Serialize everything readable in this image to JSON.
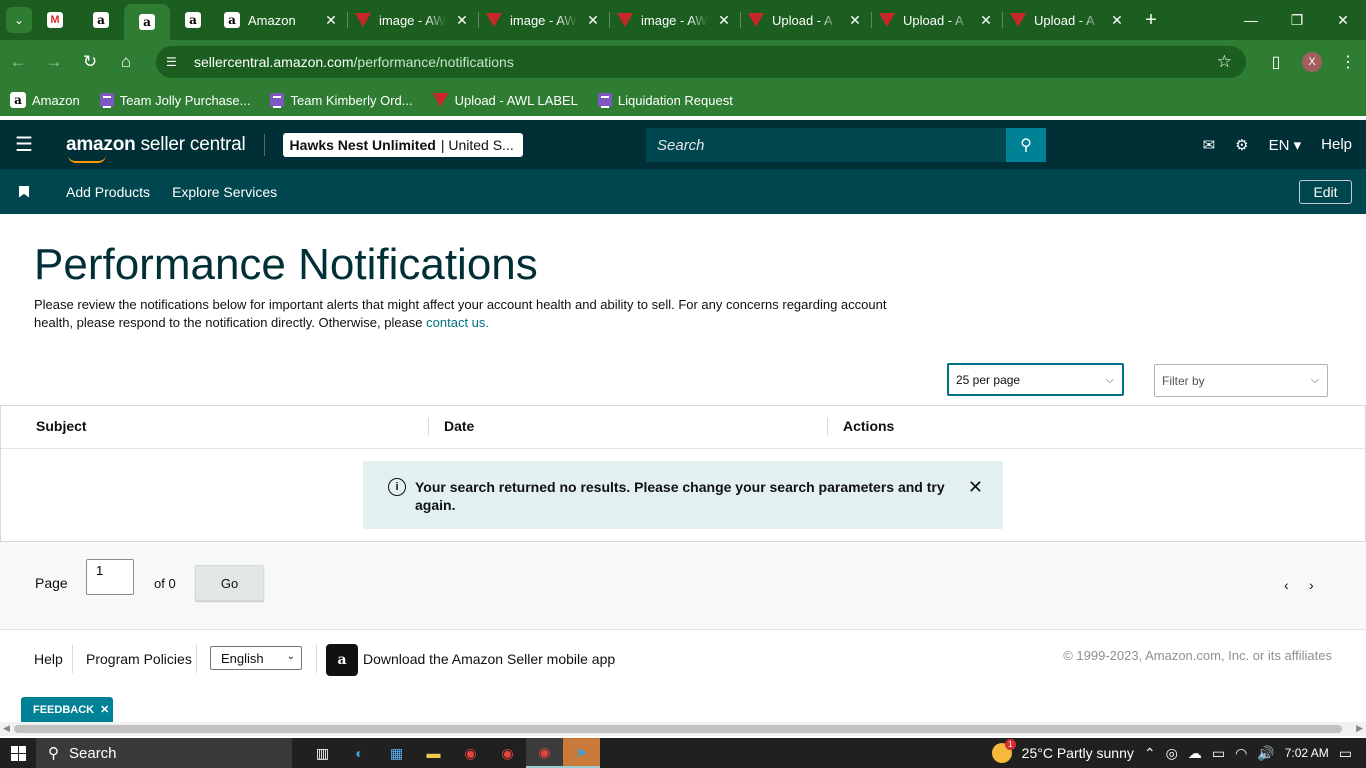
{
  "browser": {
    "tabs": [
      {
        "title": "Amazon",
        "favicon": "amazon-icon"
      },
      {
        "title": "image - AW",
        "favicon": "awl-icon"
      },
      {
        "title": "image - AW",
        "favicon": "awl-icon"
      },
      {
        "title": "image - AW",
        "favicon": "awl-icon"
      },
      {
        "title": "Upload - A",
        "favicon": "awl-icon"
      },
      {
        "title": "Upload - A",
        "favicon": "awl-icon"
      },
      {
        "title": "Upload - A",
        "favicon": "awl-icon"
      }
    ],
    "url_host": "sellercentral.amazon.com",
    "url_path": "/performance/notifications",
    "profile_initial": "X",
    "bookmarks": [
      {
        "label": "Amazon",
        "icon": "amazon-icon"
      },
      {
        "label": "Team Jolly Purchase...",
        "icon": "list-icon"
      },
      {
        "label": "Team Kimberly Ord...",
        "icon": "list-icon"
      },
      {
        "label": "Upload - AWL LABEL",
        "icon": "awl-icon"
      },
      {
        "label": "Liquidation Request",
        "icon": "list-icon"
      }
    ],
    "theme_color": "#2e7d32"
  },
  "header": {
    "logo_text_bold": "amazon",
    "logo_text": " seller central",
    "account_bold": "Hawks Nest Unlimited",
    "account_rest": "| United S...",
    "search_placeholder": "Search",
    "language": "EN",
    "help": "Help"
  },
  "subnav": {
    "links": [
      "Add Products",
      "Explore Services"
    ],
    "edit": "Edit"
  },
  "page": {
    "title": "Performance Notifications",
    "description": "Please review the notifications below for important alerts that might affect your account health and ability to sell. For any concerns regarding account health, please respond to the notification directly. Otherwise, please ",
    "contact_link": "contact us.",
    "per_page": "25 per page",
    "filter_placeholder": "Filter by",
    "columns": [
      "Subject",
      "Date",
      "Actions"
    ],
    "alert_message": "Your search returned no results. Please change your search parameters and try again.",
    "pager": {
      "label": "Page",
      "value": "1",
      "of": "of 0",
      "go": "Go"
    }
  },
  "footer": {
    "help": "Help",
    "policies": "Program Policies",
    "language": "English",
    "app_text": "Download the Amazon Seller mobile app",
    "copyright": "© 1999-2023, Amazon.com, Inc. or its affiliates",
    "feedback": "FEEDBACK"
  },
  "taskbar": {
    "search": "Search",
    "weather": "25°C  Partly sunny",
    "time": "7:02 AM"
  }
}
